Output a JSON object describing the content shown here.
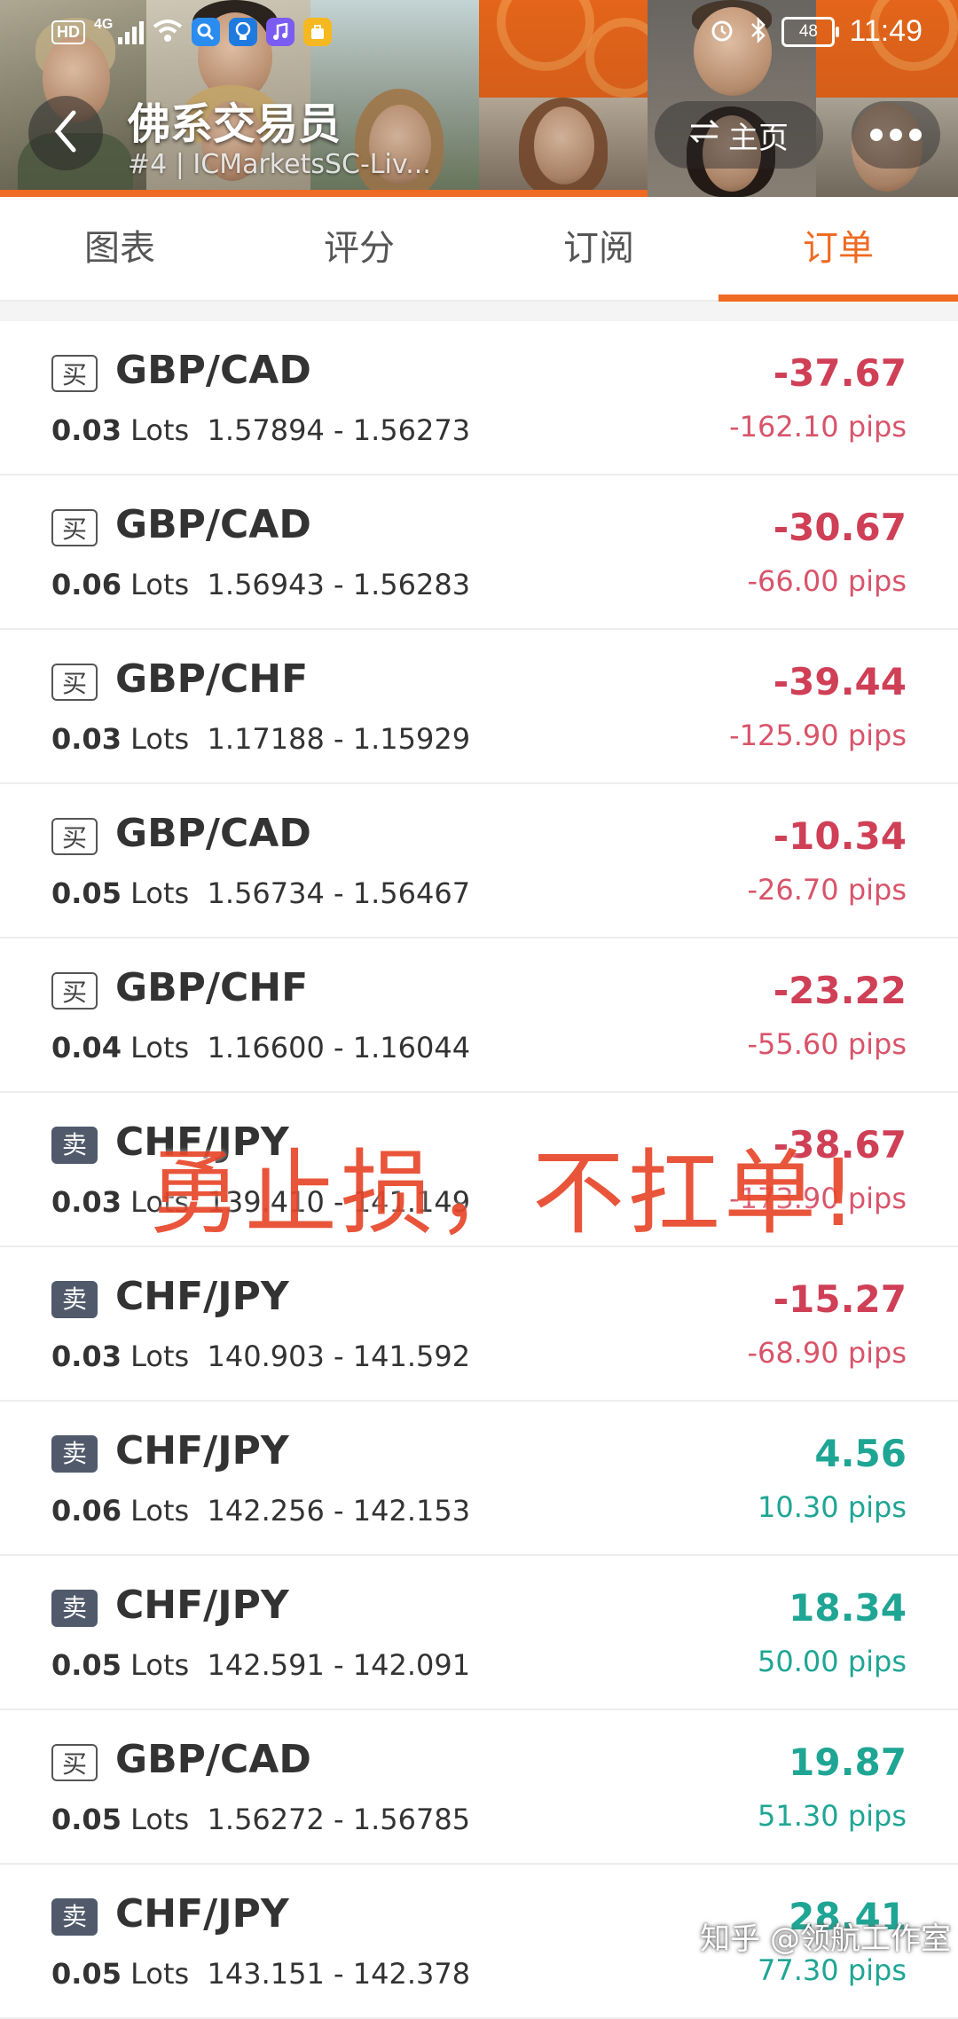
{
  "status_bar": {
    "hd": "HD",
    "network": "4G",
    "battery": "48",
    "time": "11:49"
  },
  "header": {
    "title": "佛系交易员",
    "subtitle": "#4 | ICMarketsSC-Liv...",
    "home_label": "主页",
    "accent_color": "#ef6a22"
  },
  "tabs": [
    {
      "label": "图表"
    },
    {
      "label": "评分"
    },
    {
      "label": "订阅"
    },
    {
      "label": "订单",
      "active": true
    }
  ],
  "orders": [
    {
      "side": "买",
      "symbol": "GBP/CAD",
      "lots": "0.03",
      "lots_unit": "Lots",
      "prices": "1.57894 - 1.56273",
      "profit": "-37.67",
      "pips": "-162.10 pips",
      "sign": "neg"
    },
    {
      "side": "买",
      "symbol": "GBP/CAD",
      "lots": "0.06",
      "lots_unit": "Lots",
      "prices": "1.56943 - 1.56283",
      "profit": "-30.67",
      "pips": "-66.00 pips",
      "sign": "neg"
    },
    {
      "side": "买",
      "symbol": "GBP/CHF",
      "lots": "0.03",
      "lots_unit": "Lots",
      "prices": "1.17188 - 1.15929",
      "profit": "-39.44",
      "pips": "-125.90 pips",
      "sign": "neg"
    },
    {
      "side": "买",
      "symbol": "GBP/CAD",
      "lots": "0.05",
      "lots_unit": "Lots",
      "prices": "1.56734 - 1.56467",
      "profit": "-10.34",
      "pips": "-26.70 pips",
      "sign": "neg"
    },
    {
      "side": "买",
      "symbol": "GBP/CHF",
      "lots": "0.04",
      "lots_unit": "Lots",
      "prices": "1.16600 - 1.16044",
      "profit": "-23.22",
      "pips": "-55.60 pips",
      "sign": "neg"
    },
    {
      "side": "卖",
      "symbol": "CHF/JPY",
      "lots": "0.03",
      "lots_unit": "Lots",
      "prices": "139.410 - 141.149",
      "profit": "-38.67",
      "pips": "-173.90 pips",
      "sign": "neg"
    },
    {
      "side": "卖",
      "symbol": "CHF/JPY",
      "lots": "0.03",
      "lots_unit": "Lots",
      "prices": "140.903 - 141.592",
      "profit": "-15.27",
      "pips": "-68.90 pips",
      "sign": "neg"
    },
    {
      "side": "卖",
      "symbol": "CHF/JPY",
      "lots": "0.06",
      "lots_unit": "Lots",
      "prices": "142.256 - 142.153",
      "profit": "4.56",
      "pips": "10.30 pips",
      "sign": "pos"
    },
    {
      "side": "卖",
      "symbol": "CHF/JPY",
      "lots": "0.05",
      "lots_unit": "Lots",
      "prices": "142.591 - 142.091",
      "profit": "18.34",
      "pips": "50.00 pips",
      "sign": "pos"
    },
    {
      "side": "买",
      "symbol": "GBP/CAD",
      "lots": "0.05",
      "lots_unit": "Lots",
      "prices": "1.56272 - 1.56785",
      "profit": "19.87",
      "pips": "51.30 pips",
      "sign": "pos"
    },
    {
      "side": "卖",
      "symbol": "CHF/JPY",
      "lots": "0.05",
      "lots_unit": "Lots",
      "prices": "143.151 - 142.378",
      "profit": "28.41",
      "pips": "77.30 pips",
      "sign": "pos"
    }
  ],
  "overlay_text": "勇止损，不扛单!",
  "watermark": "知乎 @领航工作室",
  "colors": {
    "loss": "#cf3f56",
    "gain": "#1fa594",
    "sell_badge": "#505a6b"
  }
}
